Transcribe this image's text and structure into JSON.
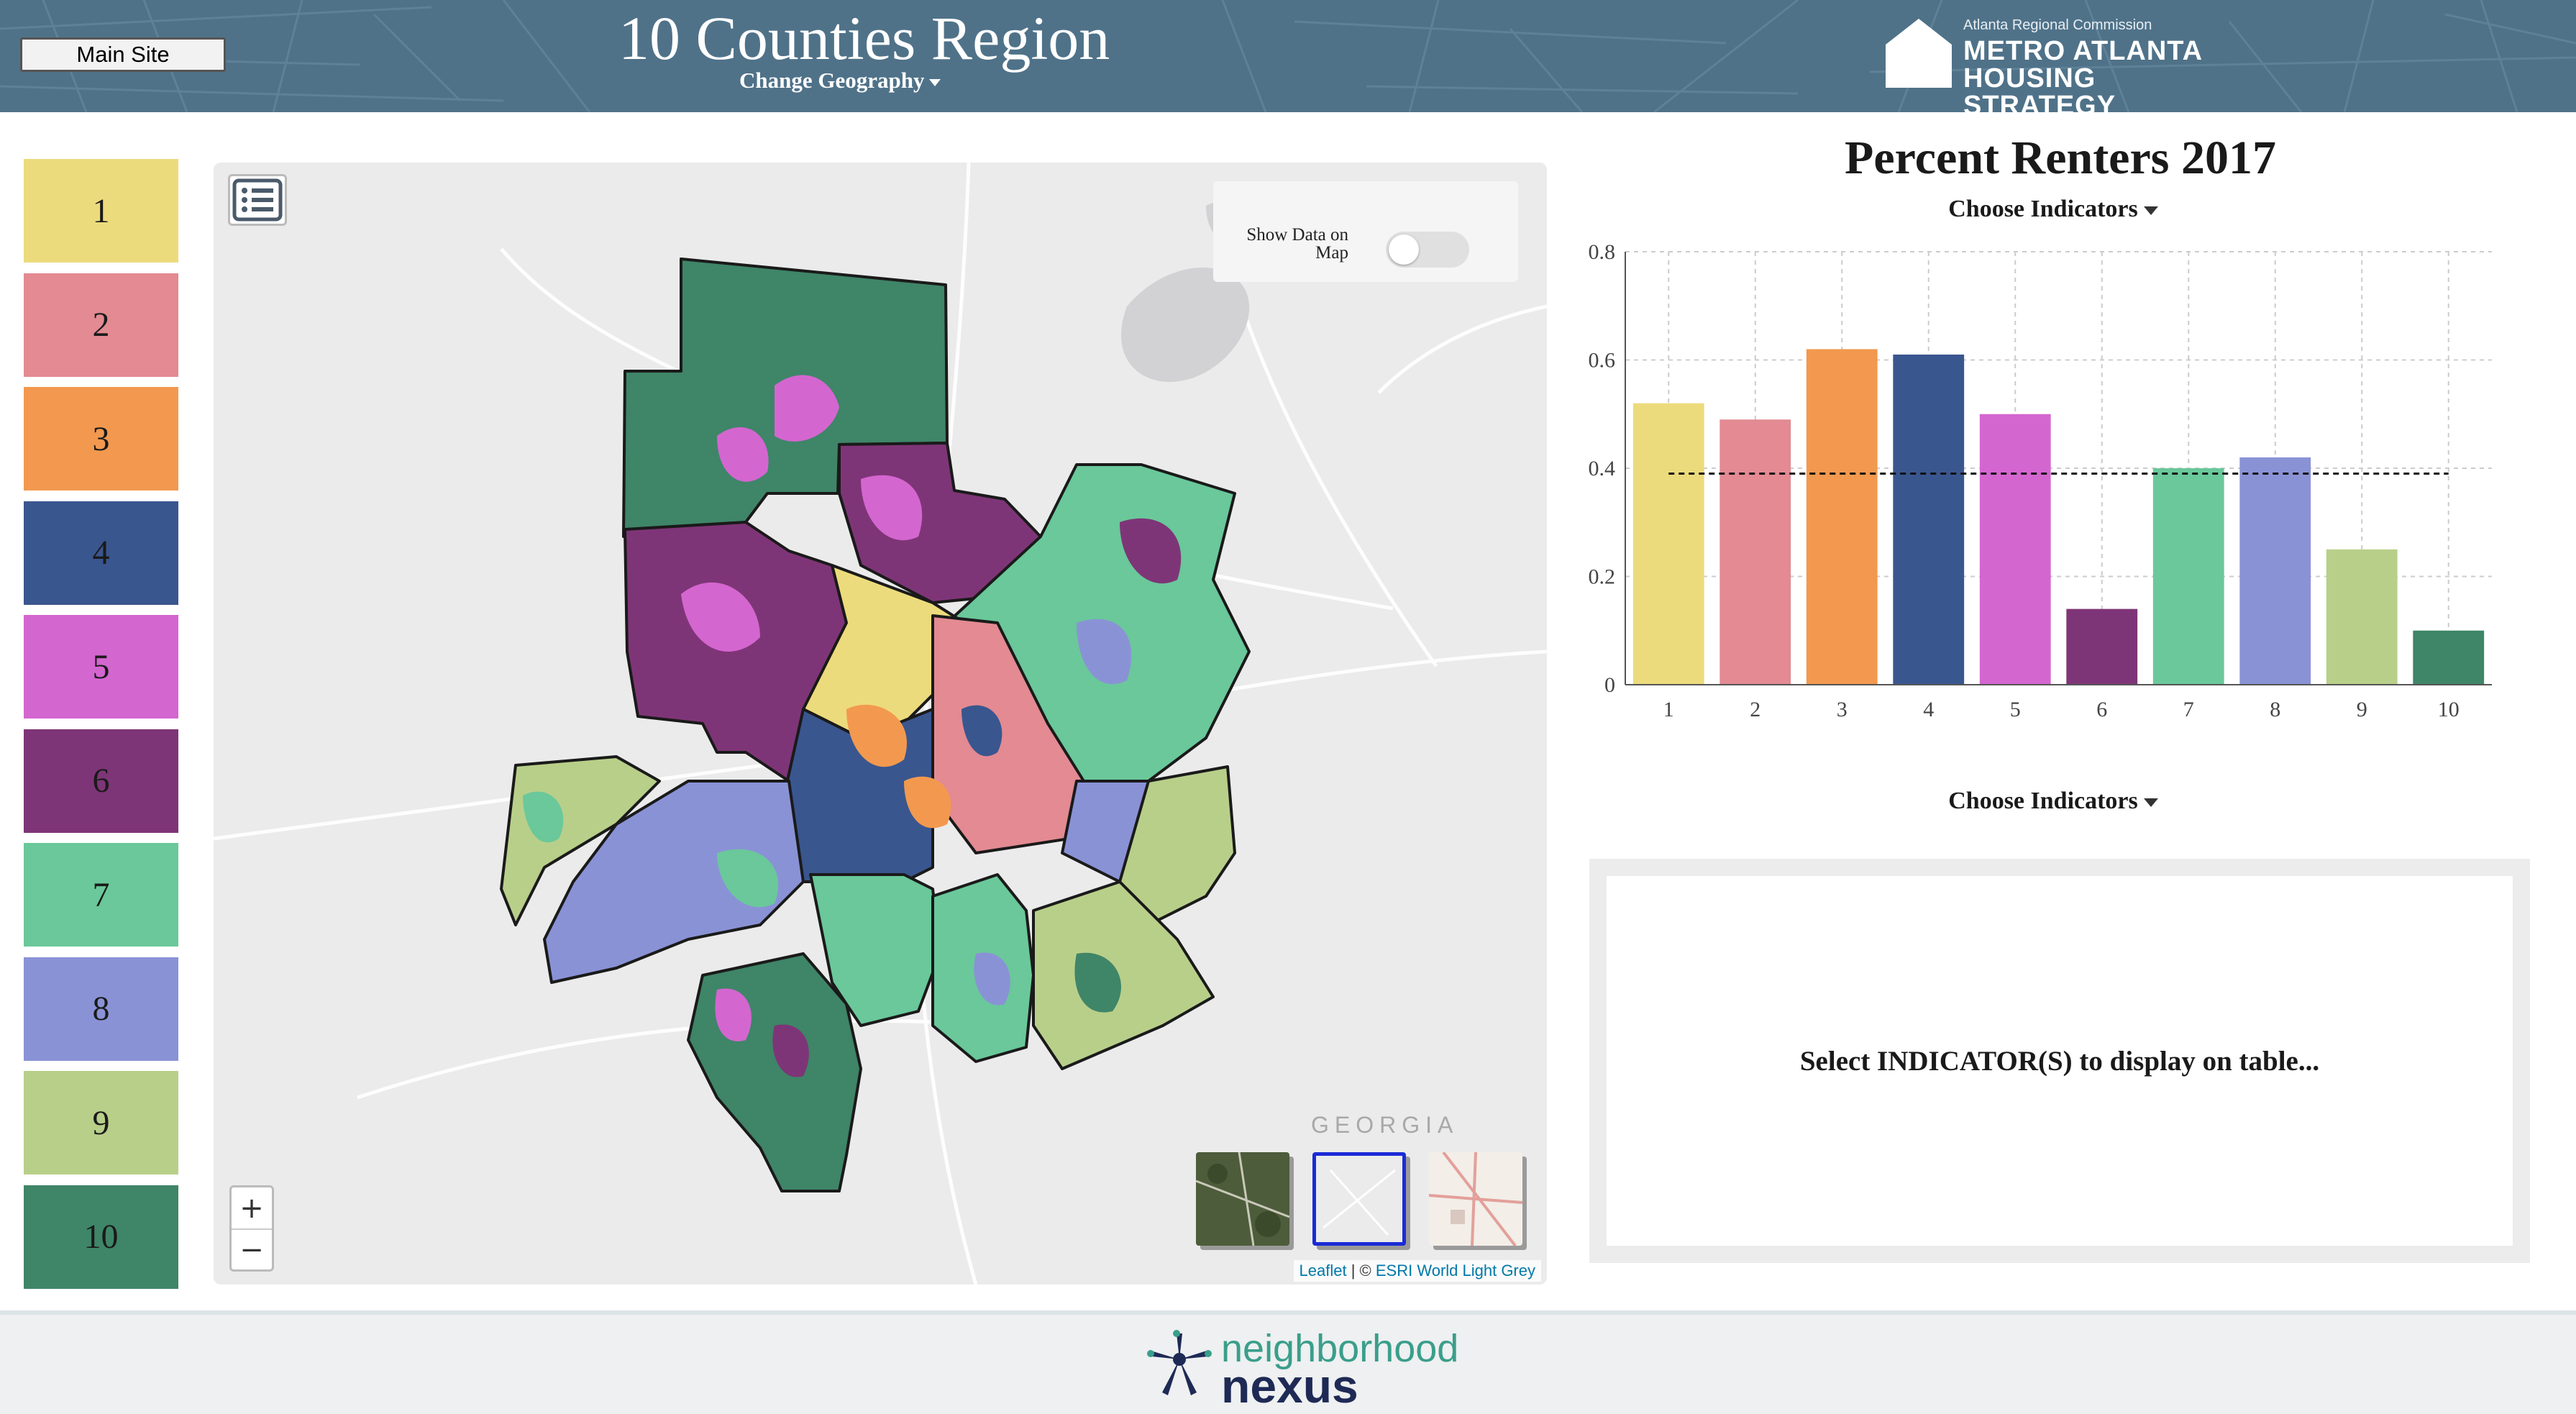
{
  "header": {
    "main_site_label": "Main Site",
    "region_title": "10 Counties Region",
    "change_geography_label": "Change Geography",
    "logo_org": "Atlanta Regional Commission",
    "logo_line1": "METRO ATLANTA",
    "logo_line2": "HOUSING STRATEGY",
    "background_color": "#4f7289"
  },
  "legend": {
    "items": [
      {
        "label": "1",
        "color": "#ecdb7c"
      },
      {
        "label": "2",
        "color": "#e38a92"
      },
      {
        "label": "3",
        "color": "#f2994f"
      },
      {
        "label": "4",
        "color": "#3a568f"
      },
      {
        "label": "5",
        "color": "#d466d0"
      },
      {
        "label": "6",
        "color": "#7e3577"
      },
      {
        "label": "7",
        "color": "#6ac89a"
      },
      {
        "label": "8",
        "color": "#8a92d6"
      },
      {
        "label": "9",
        "color": "#b8cf8a"
      },
      {
        "label": "10",
        "color": "#3f8568"
      }
    ]
  },
  "map": {
    "show_data_label": "Show Data on Map",
    "show_data_on": false,
    "zoom_in_label": "+",
    "zoom_out_label": "−",
    "region_label": "GEORGIA",
    "attribution_leaflet": "Leaflet",
    "attribution_separator": " | © ",
    "attribution_esri": "ESRI World Light Grey",
    "icons": {
      "layers": "list-icon",
      "basemaps": [
        "satellite-basemap-icon",
        "light-grey-basemap-icon",
        "street-basemap-icon"
      ]
    },
    "selected_basemap": "light-grey"
  },
  "chart_panel": {
    "title": "Percent Renters 2017",
    "choose_indicators_label": "Choose Indicators"
  },
  "chart_data": {
    "type": "bar",
    "title": "Percent Renters 2017",
    "categories": [
      "1",
      "2",
      "3",
      "4",
      "5",
      "6",
      "7",
      "8",
      "9",
      "10"
    ],
    "values": [
      0.52,
      0.49,
      0.62,
      0.61,
      0.5,
      0.14,
      0.4,
      0.42,
      0.25,
      0.1
    ],
    "colors": [
      "#ecdb7c",
      "#e38a92",
      "#f2994f",
      "#3a568f",
      "#d466d0",
      "#7e3577",
      "#6ac89a",
      "#8a92d6",
      "#b8cf8a",
      "#3f8568"
    ],
    "reference_line": 0.39,
    "yticks": [
      "0",
      "0.2",
      "0.4",
      "0.6",
      "0.8"
    ],
    "ylim": [
      0,
      0.8
    ],
    "xlabel": "",
    "ylabel": "",
    "grid": true
  },
  "table_panel": {
    "choose_indicators_label": "Choose Indicators",
    "empty_message": "Select INDICATOR(S) to display on table..."
  },
  "footer": {
    "logo_line1": "neighborhood",
    "logo_line2": "nexus"
  }
}
